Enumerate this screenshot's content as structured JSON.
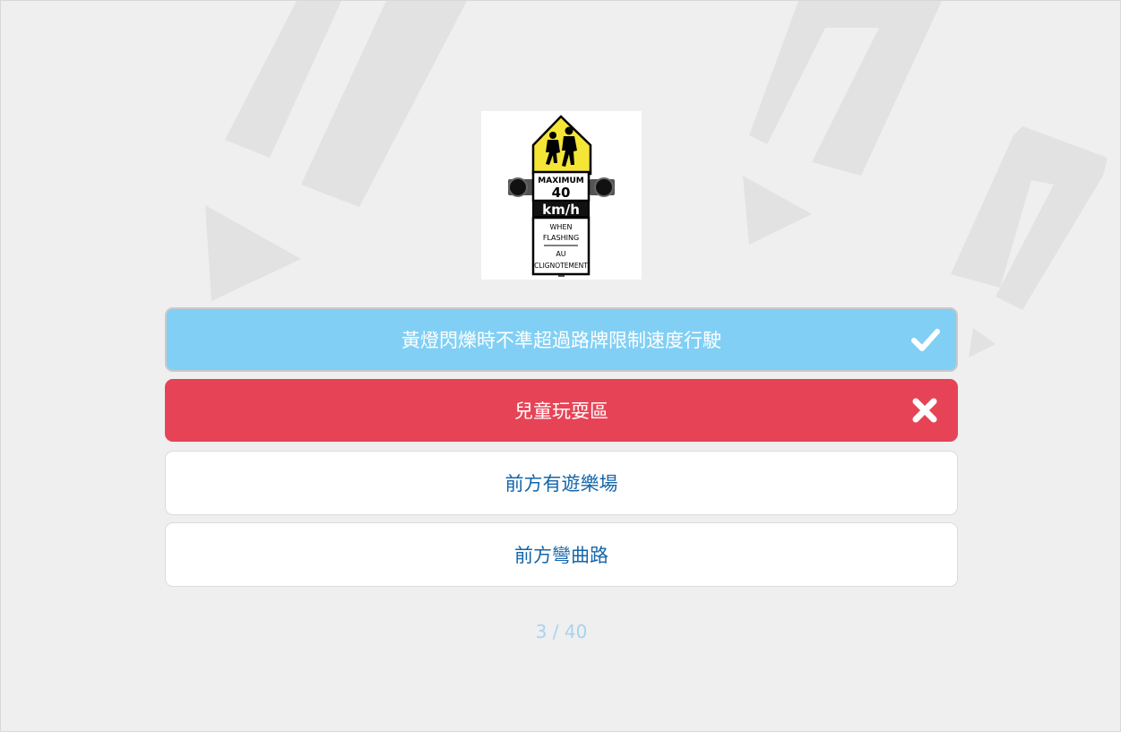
{
  "question": {
    "image_alt": "school zone speed limit sign",
    "sign_text": {
      "line1": "MAXIMUM",
      "line2": "40",
      "line3": "km/h",
      "line4": "WHEN",
      "line5": "FLASHING",
      "line6": "AU",
      "line7": "CLIGNOTEMENT"
    }
  },
  "answers": [
    {
      "label": "黃燈閃爍時不準超過路牌限制速度行駛",
      "state": "correct",
      "icon": "check-icon"
    },
    {
      "label": "兒童玩耍區",
      "state": "wrong",
      "icon": "cross-icon"
    },
    {
      "label": "前方有遊樂場",
      "state": "default"
    },
    {
      "label": "前方彎曲路",
      "state": "default"
    }
  ],
  "progress": {
    "text": "3 / 40"
  },
  "colors": {
    "background": "#efefef",
    "correct": "#81cff4",
    "wrong": "#e64456",
    "answer_text": "#1565a8",
    "progress_text": "#a8d3ee"
  }
}
